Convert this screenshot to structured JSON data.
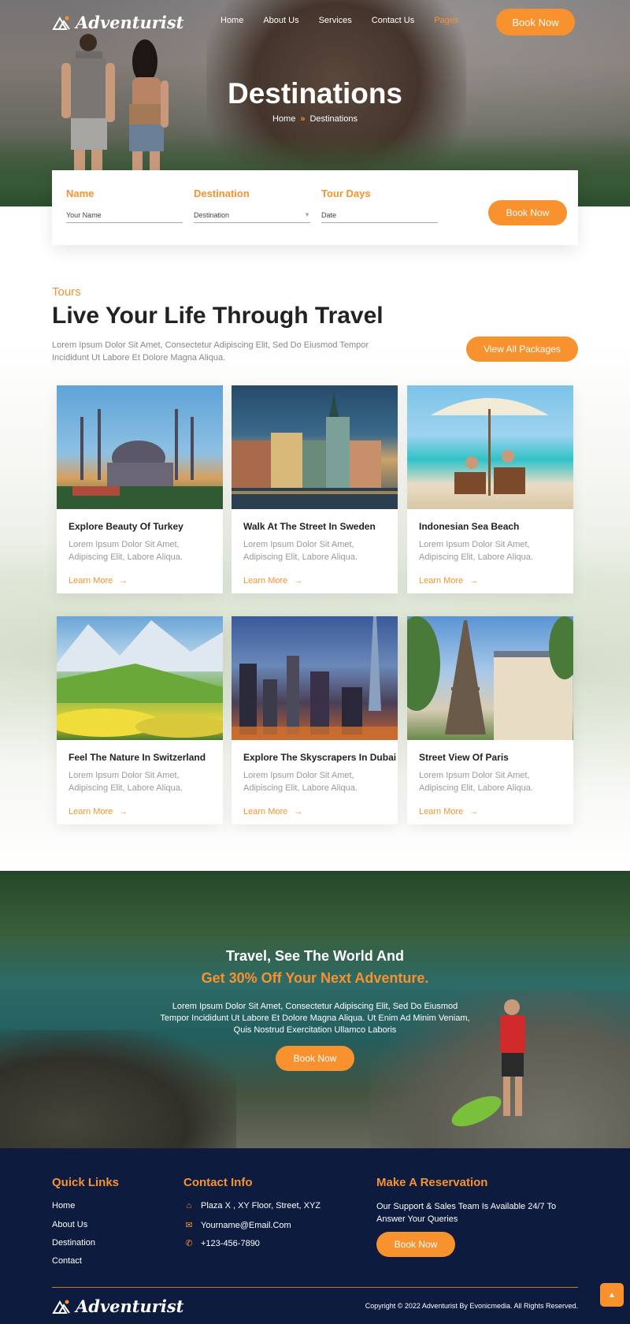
{
  "brand": {
    "name": "Adventurist"
  },
  "nav": {
    "items": [
      "Home",
      "About Us",
      "Services",
      "Contact Us",
      "Pages"
    ],
    "active_index": 4,
    "book_label": "Book Now"
  },
  "hero": {
    "title": "Destinations",
    "breadcrumb": [
      "Home",
      "Destinations"
    ]
  },
  "booking_form": {
    "fields": [
      {
        "label": "Name",
        "placeholder": "Your Name"
      },
      {
        "label": "Destination",
        "placeholder": "Destination"
      },
      {
        "label": "Tour Days",
        "placeholder": "Date"
      }
    ],
    "submit_label": "Book Now"
  },
  "tours": {
    "tag": "Tours",
    "title": "Live Your Life Through Travel",
    "description": "Lorem Ipsum Dolor Sit Amet, Consectetur Adipiscing Elit, Sed Do Eiusmod Tempor Incididunt Ut Labore Et Dolore Magna Aliqua.",
    "view_all_label": "View All Packages",
    "cards": [
      {
        "title": "Explore Beauty Of Turkey",
        "description": "Lorem Ipsum Dolor Sit Amet, Adipiscing Elit, Labore Aliqua.",
        "link": "Learn More"
      },
      {
        "title": "Walk At The Street In Sweden",
        "description": "Lorem Ipsum Dolor Sit Amet, Adipiscing Elit, Labore Aliqua.",
        "link": "Learn More"
      },
      {
        "title": "Indonesian Sea Beach",
        "description": "Lorem Ipsum Dolor Sit Amet, Adipiscing Elit, Labore Aliqua.",
        "link": "Learn More"
      },
      {
        "title": "Feel The Nature In Switzerland",
        "description": "Lorem Ipsum Dolor Sit Amet, Adipiscing Elit, Labore Aliqua.",
        "link": "Learn More"
      },
      {
        "title": "Explore The Skyscrapers In Dubai",
        "description": "Lorem Ipsum Dolor Sit Amet, Adipiscing Elit, Labore Aliqua.",
        "link": "Learn More"
      },
      {
        "title": "Street View Of Paris",
        "description": "Lorem Ipsum Dolor Sit Amet, Adipiscing Elit, Labore Aliqua.",
        "link": "Learn More"
      }
    ]
  },
  "promo": {
    "line1": "Travel, See The World And",
    "line2": "Get 30% Off Your Next Adventure.",
    "description": "Lorem Ipsum Dolor Sit Amet, Consectetur Adipiscing Elit, Sed Do Eiusmod Tempor Incididunt Ut Labore Et Dolore Magna Aliqua. Ut Enim Ad Minim Veniam, Quis Nostrud Exercitation Ullamco Laboris",
    "button_label": "Book Now"
  },
  "footer": {
    "quick_links": {
      "title": "Quick Links",
      "items": [
        "Home",
        "About Us",
        "Destination",
        "Contact"
      ]
    },
    "contact": {
      "title": "Contact Info",
      "address": "Plaza X , XY Floor, Street, XYZ",
      "email": "Yourname@Email.Com",
      "phone": "+123-456-7890"
    },
    "reservation": {
      "title": "Make A Reservation",
      "description": "Our Support & Sales Team Is Available 24/7 To Answer Your Queries",
      "button_label": "Book Now"
    },
    "copyright": "Copyright © 2022 Adventurist By Evonicmedia. All Rights Reserved."
  },
  "colors": {
    "accent": "#f7922f",
    "footer_bg": "#0d1b3e"
  },
  "icons": [
    "mountain-logo-icon",
    "double-chevron-icon",
    "dropdown-caret-icon",
    "arrow-right-icon",
    "home-icon",
    "mail-icon",
    "phone-icon",
    "chevron-up-icon"
  ]
}
